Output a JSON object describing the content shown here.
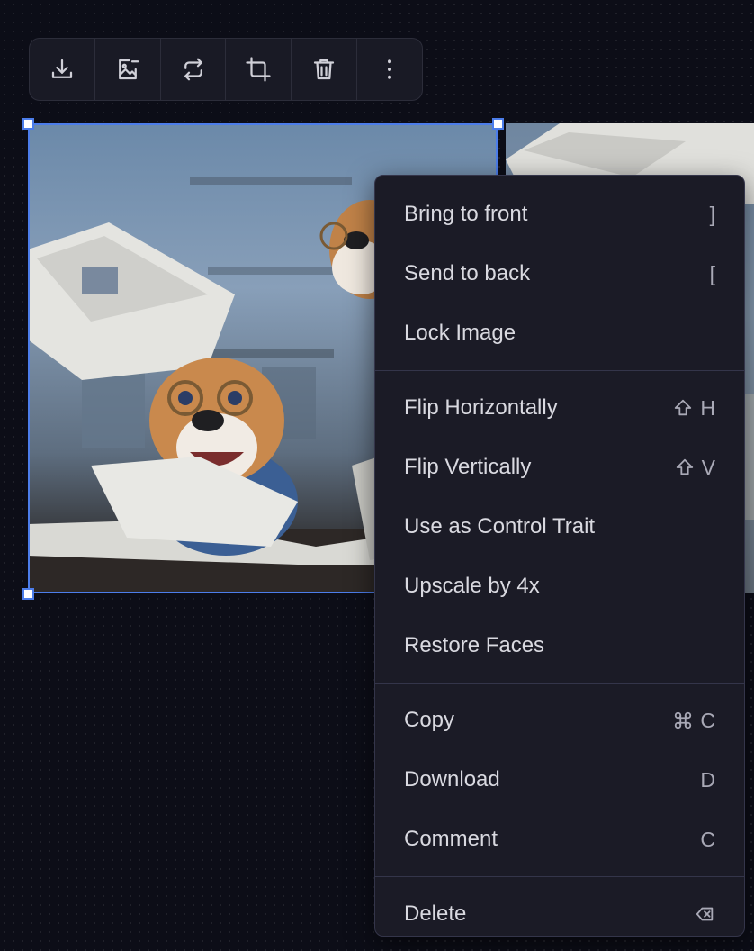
{
  "toolbar": {
    "buttons": [
      {
        "icon": "download-icon"
      },
      {
        "icon": "image-edit-icon"
      },
      {
        "icon": "repeat-icon"
      },
      {
        "icon": "crop-icon"
      },
      {
        "icon": "trash-icon"
      },
      {
        "icon": "more-vertical-icon"
      }
    ]
  },
  "context_menu": {
    "sections": [
      [
        {
          "label": "Bring to front",
          "shortcut": "]"
        },
        {
          "label": "Send to back",
          "shortcut": "["
        },
        {
          "label": "Lock Image",
          "shortcut": ""
        }
      ],
      [
        {
          "label": "Flip Horizontally",
          "shortcut_icon": "shift-icon",
          "shortcut": "H"
        },
        {
          "label": "Flip Vertically",
          "shortcut_icon": "shift-icon",
          "shortcut": "V"
        },
        {
          "label": "Use as Control Trait",
          "shortcut": ""
        },
        {
          "label": "Upscale by 4x",
          "shortcut": ""
        },
        {
          "label": "Restore Faces",
          "shortcut": ""
        }
      ],
      [
        {
          "label": "Copy",
          "shortcut_icon": "command-icon",
          "shortcut": "C"
        },
        {
          "label": "Download",
          "shortcut": "D"
        },
        {
          "label": "Comment",
          "shortcut": "C"
        }
      ],
      [
        {
          "label": "Delete",
          "shortcut_icon": "backspace-icon",
          "shortcut": ""
        }
      ]
    ]
  },
  "colors": {
    "canvas_bg": "#0c0d17",
    "selection": "#4c7dea",
    "menu_bg": "#1b1b26",
    "menu_text": "#d9d9e0"
  }
}
